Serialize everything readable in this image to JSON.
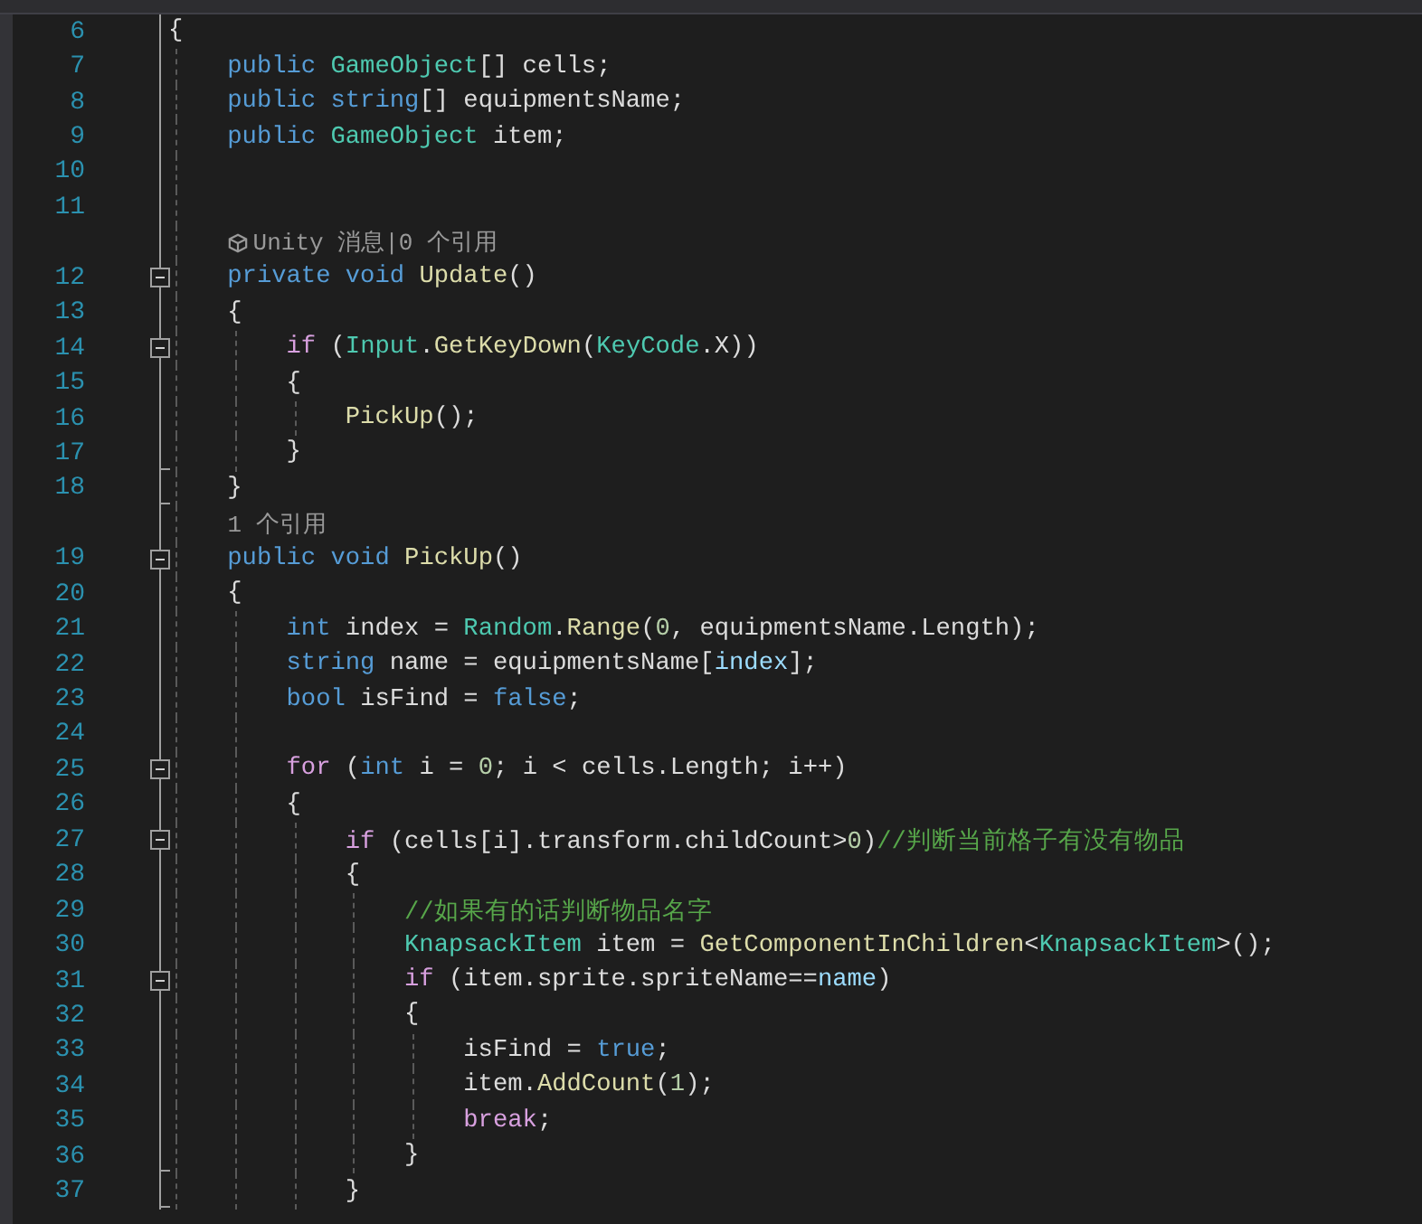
{
  "lines": [
    {
      "kind": "code",
      "number": "6",
      "tokens": [
        {
          "kind": "plain",
          "text": "{"
        }
      ]
    },
    {
      "kind": "code",
      "number": "7",
      "tokens": [
        {
          "kind": "kw",
          "text": "    public "
        },
        {
          "kind": "type",
          "text": "GameObject"
        },
        {
          "kind": "plain",
          "text": "[] cells;"
        }
      ]
    },
    {
      "kind": "code",
      "number": "8",
      "tokens": [
        {
          "kind": "kw",
          "text": "    public string"
        },
        {
          "kind": "plain",
          "text": "[] equipmentsName;"
        }
      ]
    },
    {
      "kind": "code",
      "number": "9",
      "tokens": [
        {
          "kind": "kw",
          "text": "    public "
        },
        {
          "kind": "type",
          "text": "GameObject"
        },
        {
          "kind": "plain",
          "text": " item;"
        }
      ]
    },
    {
      "kind": "code",
      "number": "10"
    },
    {
      "kind": "code",
      "number": "11"
    },
    {
      "kind": "codelens",
      "icon": true,
      "text": "Unity 消息|0 个引用"
    },
    {
      "kind": "code",
      "number": "12",
      "collapsible": true,
      "tokens": [
        {
          "kind": "kw",
          "text": "    private void "
        },
        {
          "kind": "fn",
          "text": "Update"
        },
        {
          "kind": "plain",
          "text": "()"
        }
      ]
    },
    {
      "kind": "code",
      "number": "13",
      "tokens": [
        {
          "kind": "plain",
          "text": "    {"
        }
      ]
    },
    {
      "kind": "code",
      "number": "14",
      "collapsible": true,
      "tokens": [
        {
          "kind": "ctl",
          "text": "        if "
        },
        {
          "kind": "plain",
          "text": "("
        },
        {
          "kind": "type",
          "text": "Input"
        },
        {
          "kind": "plain",
          "text": "."
        },
        {
          "kind": "fn",
          "text": "GetKeyDown"
        },
        {
          "kind": "plain",
          "text": "("
        },
        {
          "kind": "type",
          "text": "KeyCode"
        },
        {
          "kind": "plain",
          "text": ".X))"
        }
      ]
    },
    {
      "kind": "code",
      "number": "15",
      "tokens": [
        {
          "kind": "plain",
          "text": "        {"
        }
      ]
    },
    {
      "kind": "code",
      "number": "16",
      "tokens": [
        {
          "kind": "fn",
          "text": "            PickUp"
        },
        {
          "kind": "plain",
          "text": "();"
        }
      ]
    },
    {
      "kind": "code",
      "number": "17",
      "fold_end": true,
      "tokens": [
        {
          "kind": "plain",
          "text": "        }"
        }
      ]
    },
    {
      "kind": "code",
      "number": "18",
      "fold_end": true,
      "tokens": [
        {
          "kind": "plain",
          "text": "    }"
        }
      ]
    },
    {
      "kind": "codelens",
      "icon": false,
      "text": "1 个引用"
    },
    {
      "kind": "code",
      "number": "19",
      "collapsible": true,
      "tokens": [
        {
          "kind": "kw",
          "text": "    public void "
        },
        {
          "kind": "fn",
          "text": "PickUp"
        },
        {
          "kind": "plain",
          "text": "()"
        }
      ]
    },
    {
      "kind": "code",
      "number": "20",
      "tokens": [
        {
          "kind": "plain",
          "text": "    {"
        }
      ]
    },
    {
      "kind": "code",
      "number": "21",
      "tokens": [
        {
          "kind": "kw",
          "text": "        int "
        },
        {
          "kind": "plain",
          "text": "index = "
        },
        {
          "kind": "type",
          "text": "Random"
        },
        {
          "kind": "plain",
          "text": "."
        },
        {
          "kind": "fn",
          "text": "Range"
        },
        {
          "kind": "plain",
          "text": "("
        },
        {
          "kind": "num",
          "text": "0"
        },
        {
          "kind": "plain",
          "text": ", equipmentsName.Length);"
        }
      ]
    },
    {
      "kind": "code",
      "number": "22",
      "tokens": [
        {
          "kind": "kw",
          "text": "        string "
        },
        {
          "kind": "plain",
          "text": "name = equipmentsName["
        },
        {
          "kind": "local",
          "text": "index"
        },
        {
          "kind": "plain",
          "text": "];"
        }
      ]
    },
    {
      "kind": "code",
      "number": "23",
      "tokens": [
        {
          "kind": "kw",
          "text": "        bool "
        },
        {
          "kind": "plain",
          "text": "isFind = "
        },
        {
          "kind": "kw",
          "text": "false"
        },
        {
          "kind": "plain",
          "text": ";"
        }
      ]
    },
    {
      "kind": "code",
      "number": "24"
    },
    {
      "kind": "code",
      "number": "25",
      "collapsible": true,
      "tokens": [
        {
          "kind": "ctl",
          "text": "        for "
        },
        {
          "kind": "plain",
          "text": "("
        },
        {
          "kind": "kw",
          "text": "int "
        },
        {
          "kind": "plain",
          "text": "i = "
        },
        {
          "kind": "num",
          "text": "0"
        },
        {
          "kind": "plain",
          "text": "; i < cells.Length; i++)"
        }
      ]
    },
    {
      "kind": "code",
      "number": "26",
      "tokens": [
        {
          "kind": "plain",
          "text": "        {"
        }
      ]
    },
    {
      "kind": "code",
      "number": "27",
      "collapsible": true,
      "tokens": [
        {
          "kind": "ctl",
          "text": "            if "
        },
        {
          "kind": "plain",
          "text": "(cells[i].transform.childCount>"
        },
        {
          "kind": "num",
          "text": "0"
        },
        {
          "kind": "plain",
          "text": ")"
        },
        {
          "kind": "cmt",
          "text": "//判断当前格子有没有物品"
        }
      ]
    },
    {
      "kind": "code",
      "number": "28",
      "tokens": [
        {
          "kind": "plain",
          "text": "            {"
        }
      ]
    },
    {
      "kind": "code",
      "number": "29",
      "tokens": [
        {
          "kind": "cmt",
          "text": "                //如果有的话判断物品名字"
        }
      ]
    },
    {
      "kind": "code",
      "number": "30",
      "tokens": [
        {
          "kind": "type",
          "text": "                KnapsackItem"
        },
        {
          "kind": "plain",
          "text": " item = "
        },
        {
          "kind": "fn",
          "text": "GetComponentInChildren"
        },
        {
          "kind": "plain",
          "text": "<"
        },
        {
          "kind": "type",
          "text": "KnapsackItem"
        },
        {
          "kind": "plain",
          "text": ">();"
        }
      ]
    },
    {
      "kind": "code",
      "number": "31",
      "collapsible": true,
      "tokens": [
        {
          "kind": "ctl",
          "text": "                if "
        },
        {
          "kind": "plain",
          "text": "(item.sprite.spriteName=="
        },
        {
          "kind": "local",
          "text": "name"
        },
        {
          "kind": "plain",
          "text": ")"
        }
      ]
    },
    {
      "kind": "code",
      "number": "32",
      "tokens": [
        {
          "kind": "plain",
          "text": "                {"
        }
      ]
    },
    {
      "kind": "code",
      "number": "33",
      "tokens": [
        {
          "kind": "plain",
          "text": "                    isFind = "
        },
        {
          "kind": "kw",
          "text": "true"
        },
        {
          "kind": "plain",
          "text": ";"
        }
      ]
    },
    {
      "kind": "code",
      "number": "34",
      "tokens": [
        {
          "kind": "plain",
          "text": "                    item."
        },
        {
          "kind": "fn",
          "text": "AddCount"
        },
        {
          "kind": "plain",
          "text": "("
        },
        {
          "kind": "num",
          "text": "1"
        },
        {
          "kind": "plain",
          "text": ");"
        }
      ]
    },
    {
      "kind": "code",
      "number": "35",
      "tokens": [
        {
          "kind": "ctl",
          "text": "                    break"
        },
        {
          "kind": "plain",
          "text": ";"
        }
      ]
    },
    {
      "kind": "code",
      "number": "36",
      "fold_end": true,
      "tokens": [
        {
          "kind": "plain",
          "text": "                }"
        }
      ]
    },
    {
      "kind": "code",
      "number": "37",
      "fold_end": true,
      "tokens": [
        {
          "kind": "plain",
          "text": "            }"
        }
      ]
    }
  ]
}
